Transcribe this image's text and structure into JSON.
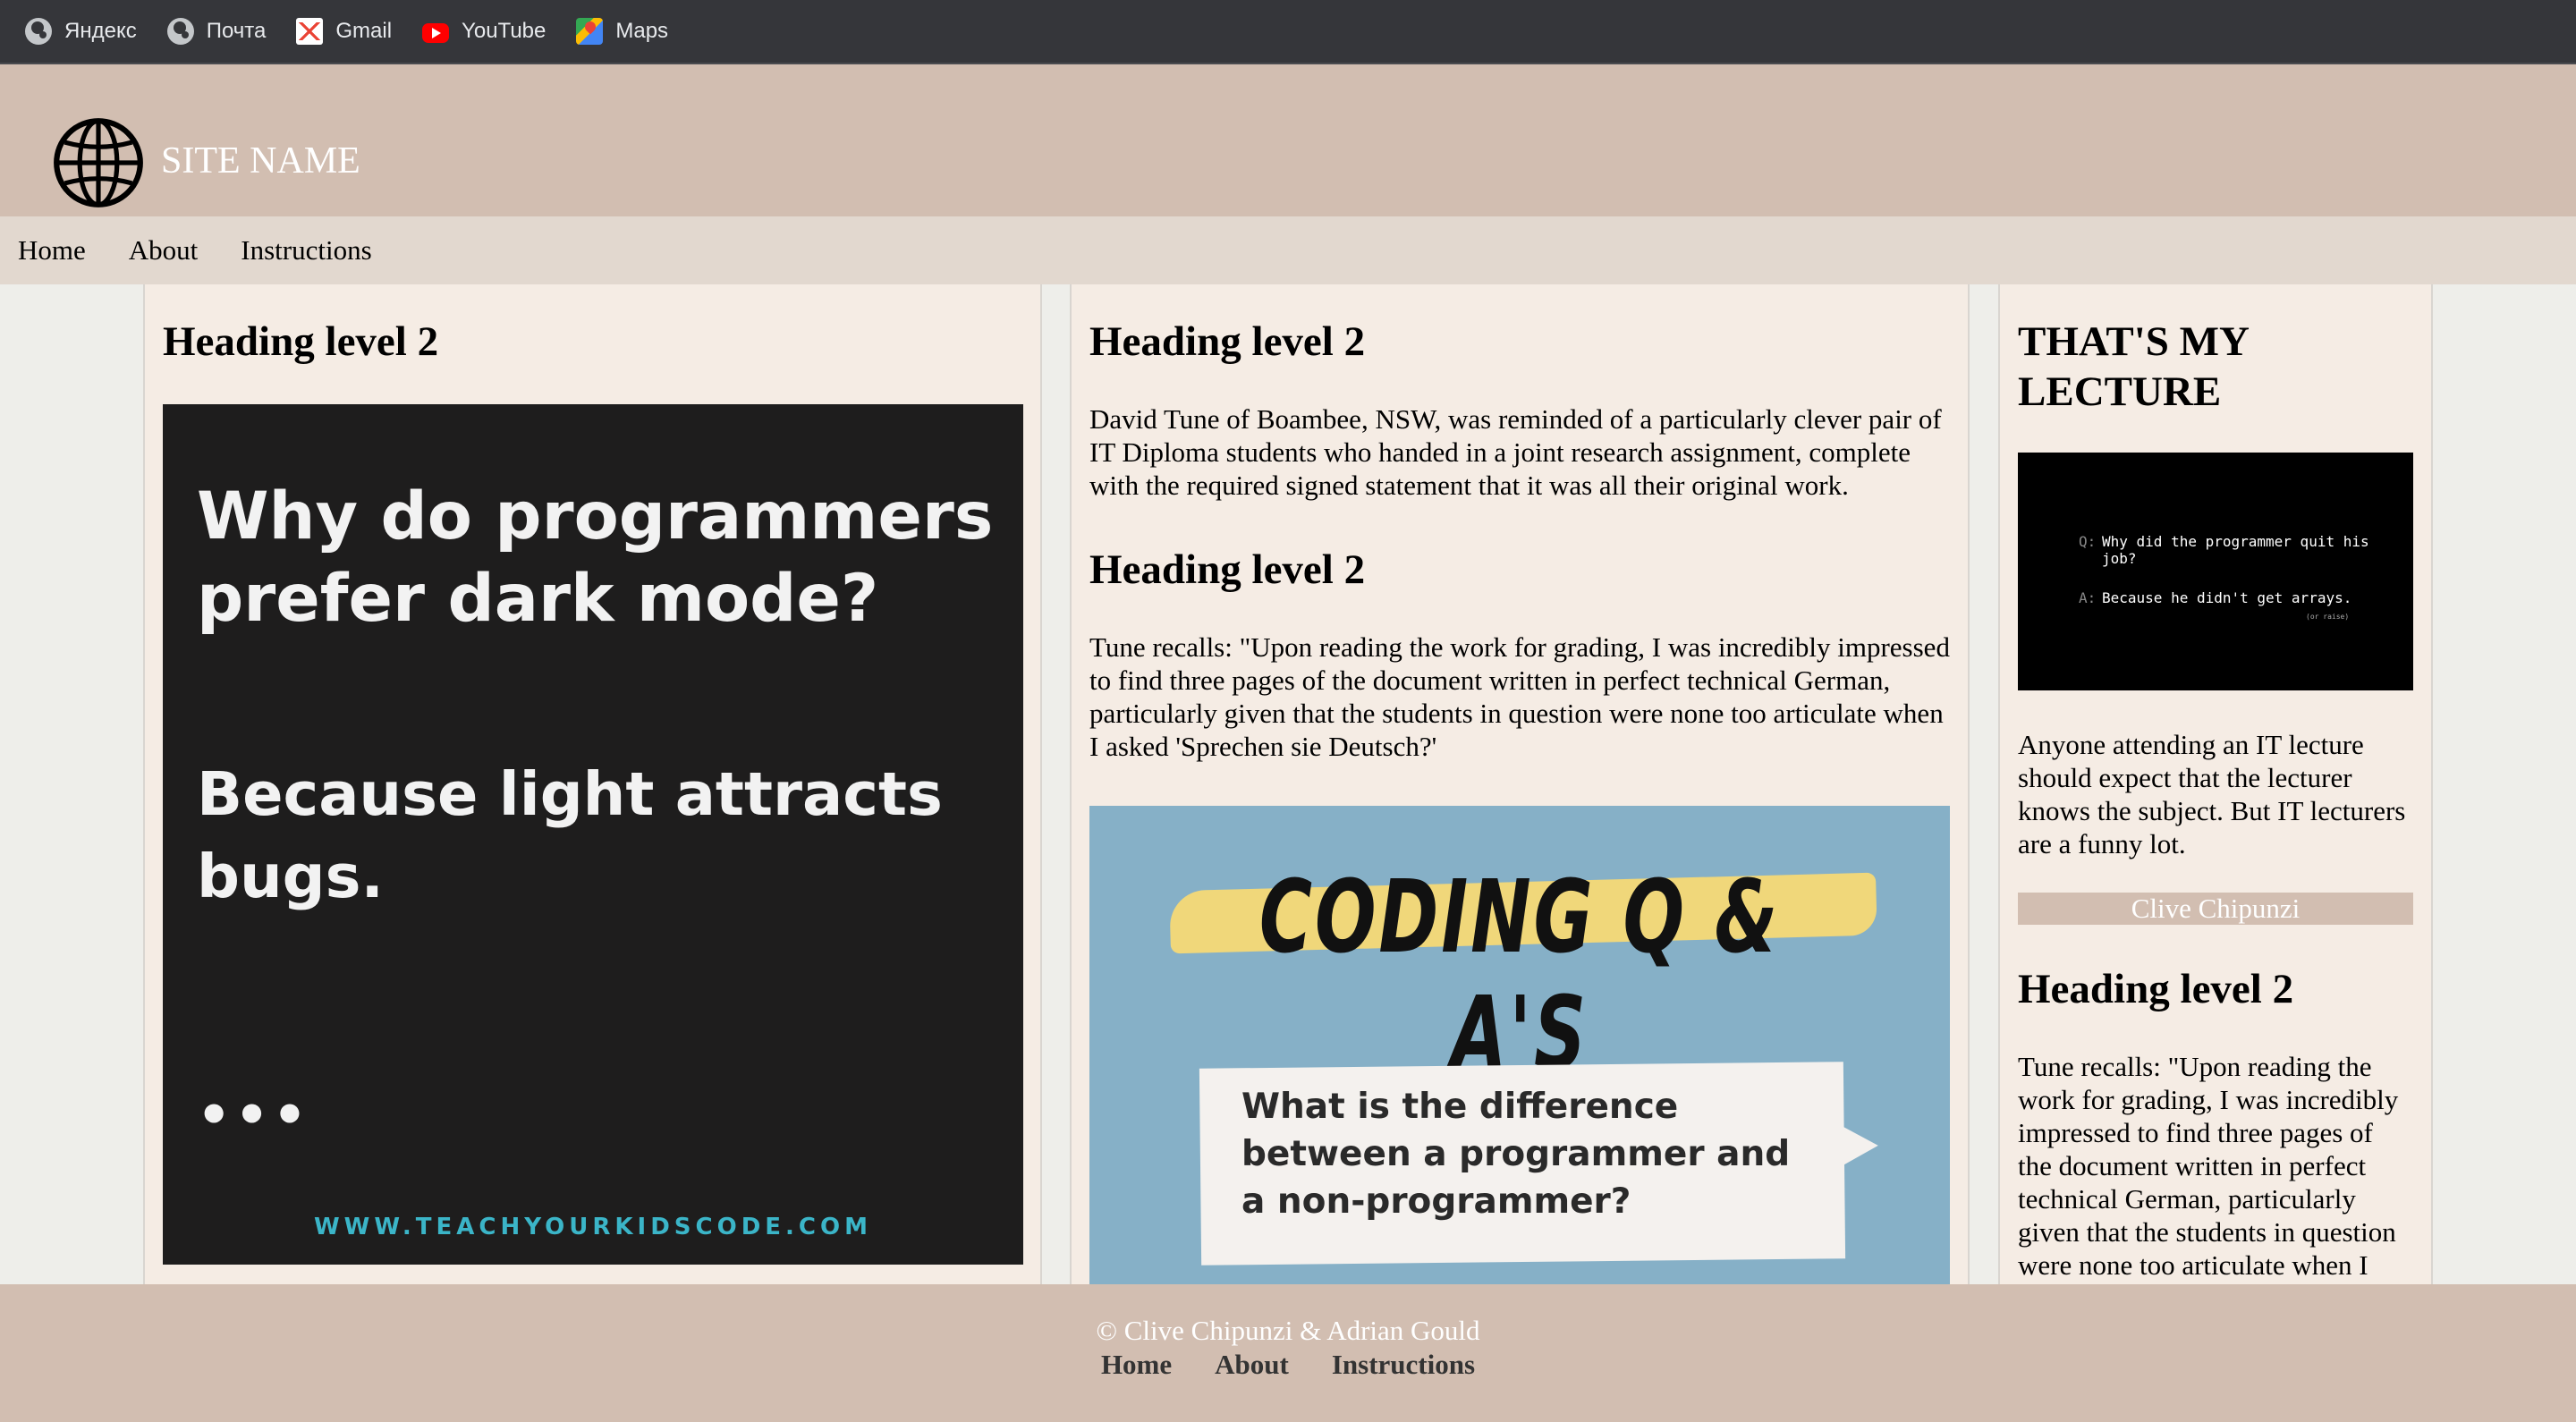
{
  "bookmarks": [
    {
      "label": "Яндекс",
      "icon": "globe-icon"
    },
    {
      "label": "Почта",
      "icon": "globe-icon"
    },
    {
      "label": "Gmail",
      "icon": "gmail-icon"
    },
    {
      "label": "YouTube",
      "icon": "youtube-icon"
    },
    {
      "label": "Maps",
      "icon": "maps-icon"
    }
  ],
  "header": {
    "site_name": "SITE NAME",
    "logo_icon": "globe-icon"
  },
  "nav": {
    "items": [
      "Home",
      "About",
      "Instructions"
    ]
  },
  "col1": {
    "heading": "Heading level 2",
    "image": {
      "question": "Why do programmers prefer dark mode?",
      "answer": "Because light attracts bugs.",
      "dots": "•••",
      "url": "WWW.TEACHYOURKIDSCODE.COM"
    }
  },
  "col2": {
    "heading1": "Heading level 2",
    "para1": "David Tune of Boambee, NSW, was reminded of a particularly clever pair of IT Diploma students who handed in a joint research assignment, complete with the required signed statement that it was all their original work.",
    "heading2": "Heading level 2",
    "para2": "Tune recalls: \"Upon reading the work for grading, I was incredibly impressed to find three pages of the document written in perfect technical German, particularly given that the students in question were none too articulate when I asked 'Sprechen sie Deutsch?'",
    "image": {
      "title": "CODING Q & A'S",
      "bubble": "What is the difference between a programmer and a non-programmer?"
    }
  },
  "col3": {
    "heading": "THAT'S MY LECTURE",
    "image": {
      "q_label": "Q:",
      "question": "Why did the programmer quit his job?",
      "a_label": "A:",
      "answer": "Because he didn't get arrays.",
      "small": "(or raise)"
    },
    "para1": "Anyone attending an IT lecture should expect that the lecturer knows the subject. But IT lecturers are a funny lot.",
    "attribution": "Clive Chipunzi",
    "heading2": "Heading level 2",
    "para2": "Tune recalls: \"Upon reading the work for grading, I was incredibly impressed to find three pages of the document written in perfect technical German, particularly given that the students in question were none too articulate when I asked 'Sprechen sie Deutsch?'"
  },
  "footer": {
    "copyright": "© Clive Chipunzi & Adrian Gould",
    "links": [
      "Home",
      "About",
      "Instructions"
    ]
  }
}
